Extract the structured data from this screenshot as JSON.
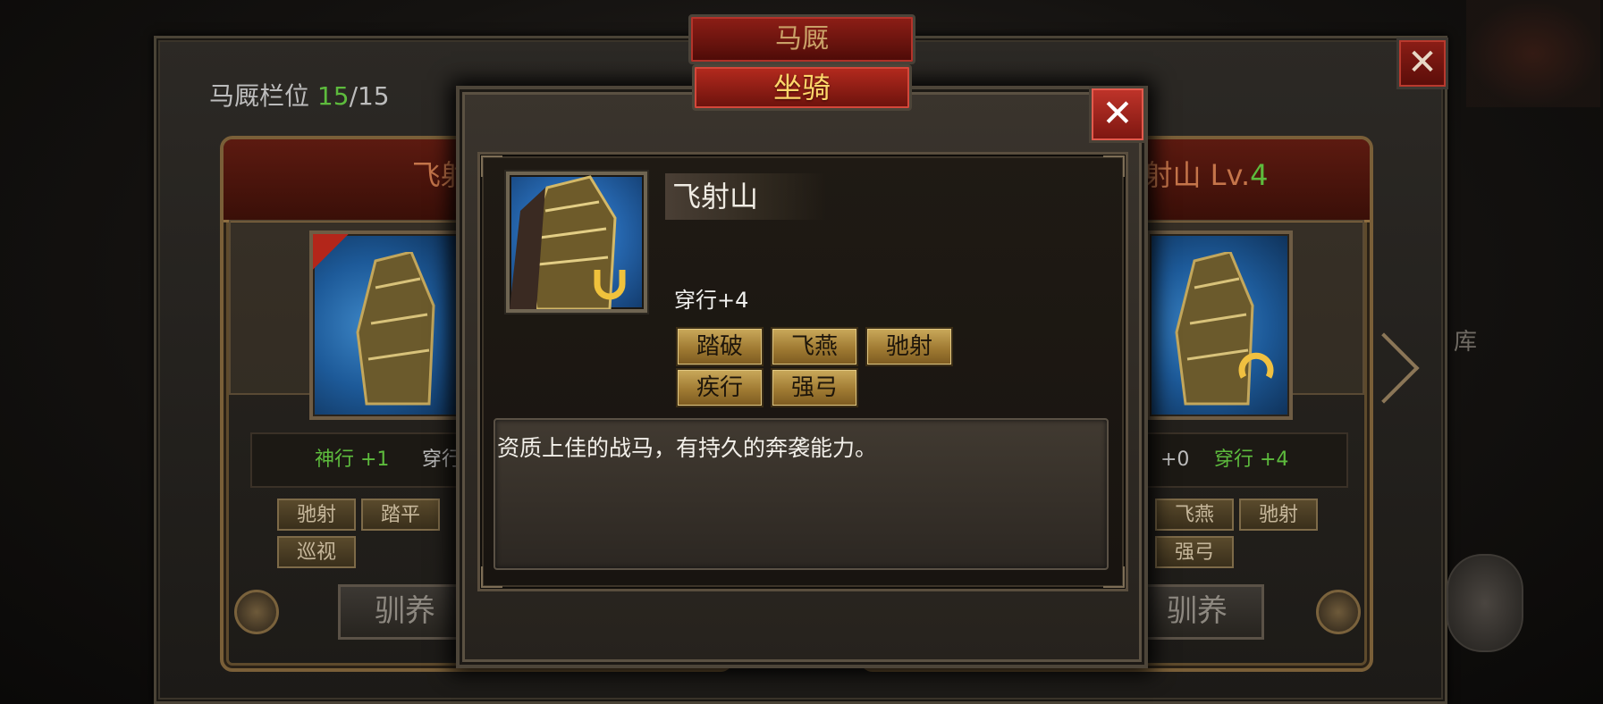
{
  "stable": {
    "title": "马厩",
    "close_label": "✕",
    "slot_label": "马厩栏位",
    "slot_used": "15",
    "slot_total": "/15",
    "left_card": {
      "name": "飞射山2 L",
      "stat_a": "神行 +1",
      "stat_b": "穿行",
      "skills": [
        "驰射",
        "踏平",
        "巡视"
      ],
      "train_label": "驯养"
    },
    "right_card": {
      "name": "射山 Lv.",
      "level": "4",
      "stat_a": "+0",
      "stat_b": "穿行 +4",
      "skills": [
        "飞燕",
        "驰射",
        "强弓"
      ],
      "train_label": "驯养"
    },
    "side_text": "库"
  },
  "popup": {
    "title": "坐骑",
    "close_label": "✕",
    "mount_name": "飞射山",
    "attribute": "穿行+4",
    "skills": [
      "踏破",
      "飞燕",
      "驰射",
      "疾行",
      "强弓"
    ],
    "description": "资质上佳的战马，有持久的奔袭能力。"
  },
  "colors": {
    "accent_gold": "#ffd76a",
    "level_green": "#5dbb3d",
    "title_red": "#b52a1e"
  }
}
